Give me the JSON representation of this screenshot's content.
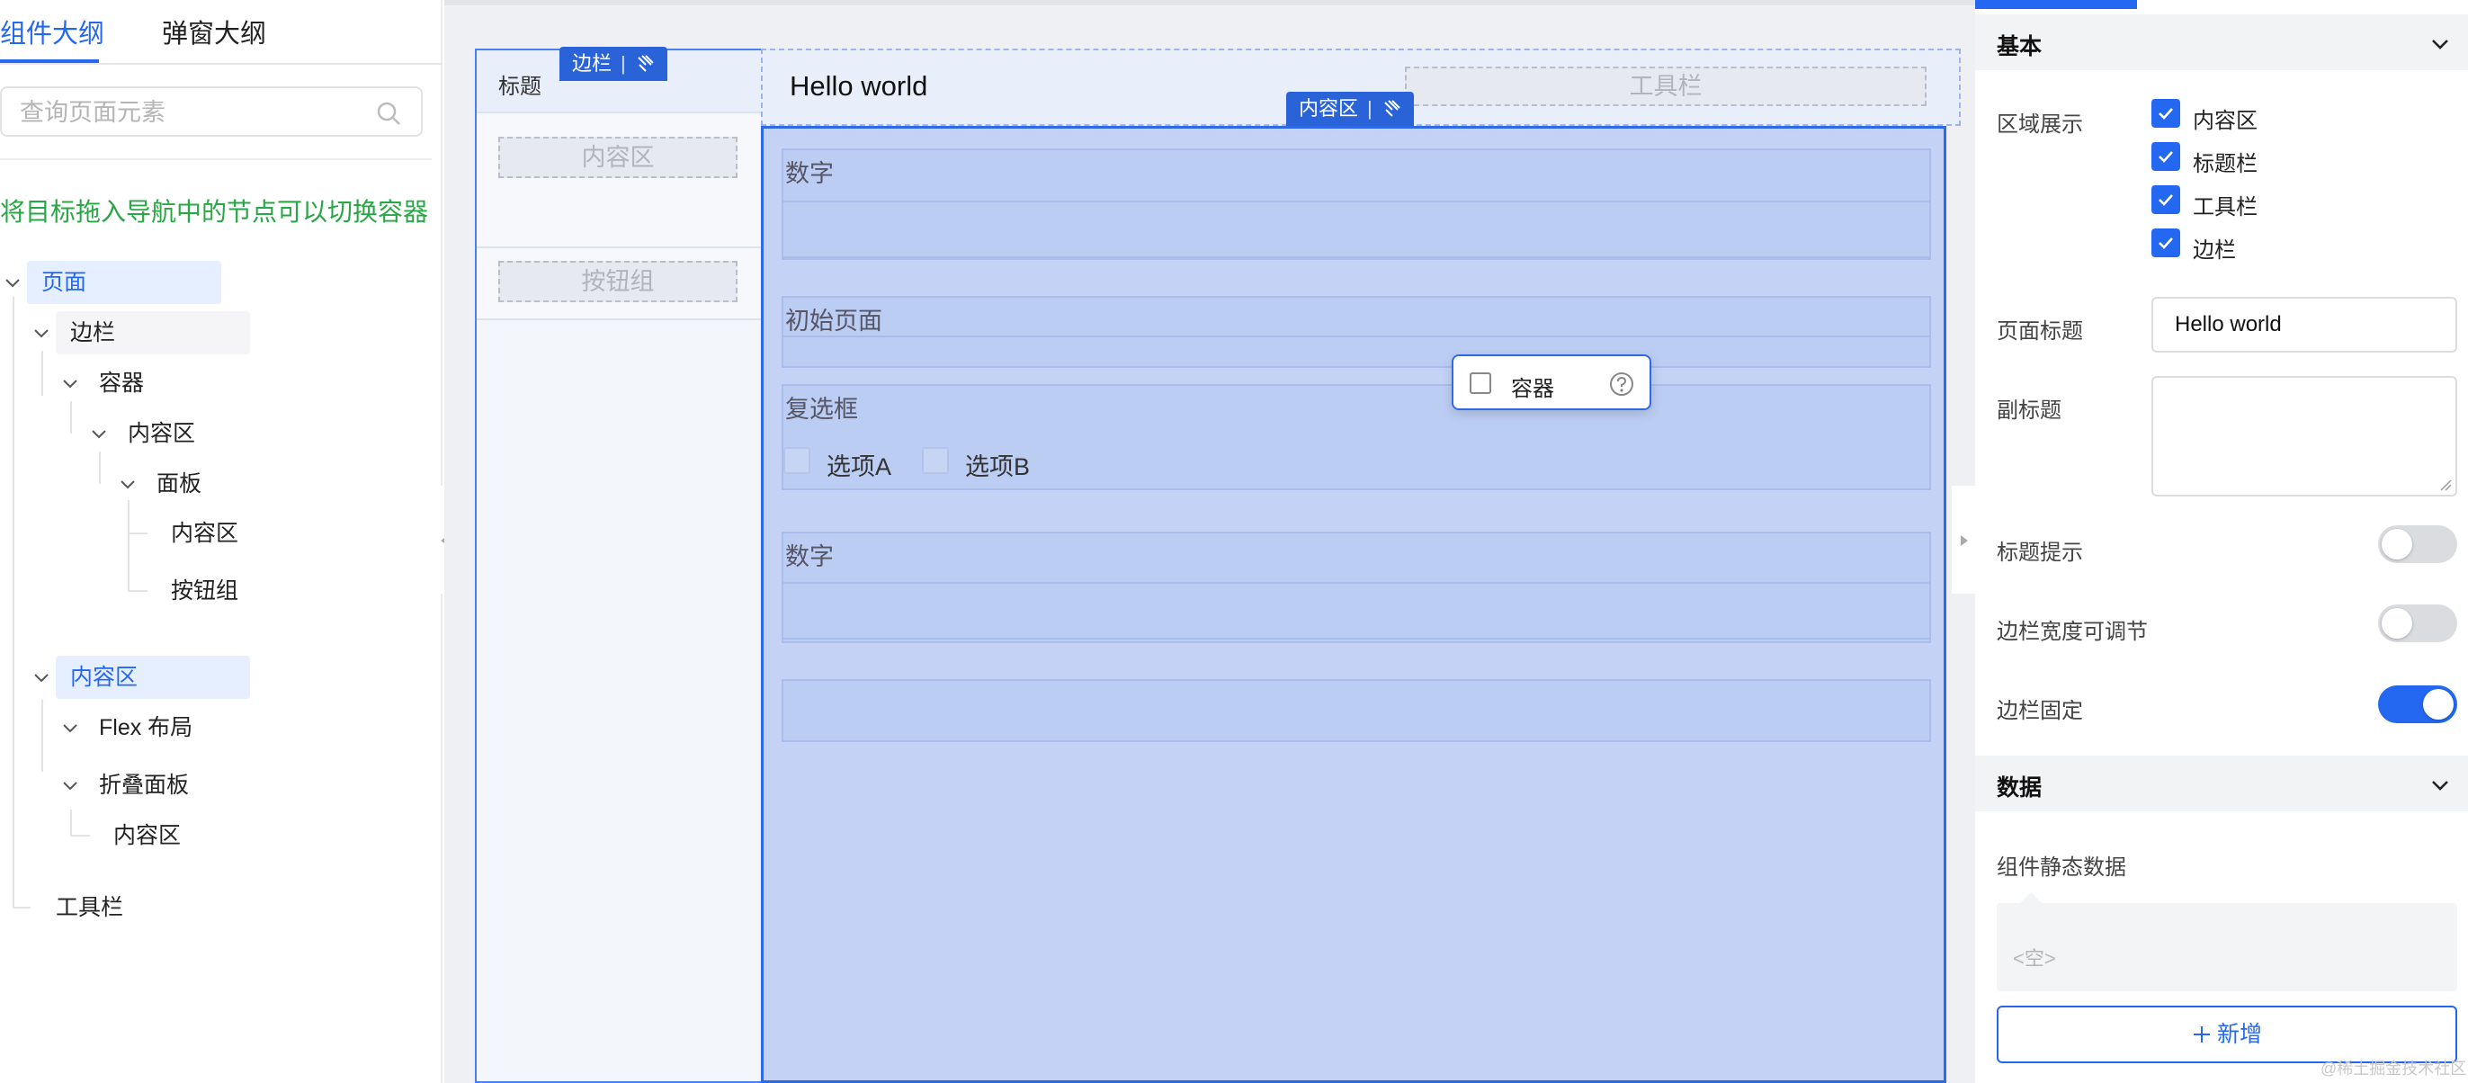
{
  "left_panel": {
    "tabs": [
      {
        "label": "组件大纲",
        "active": true
      },
      {
        "label": "弹窗大纲",
        "active": false
      }
    ],
    "search_placeholder": "查询页面元素",
    "hint": "将目标拖入导航中的节点可以切换容器",
    "tree": {
      "page": "页面",
      "aside": "边栏",
      "container": "容器",
      "content_a": "内容区",
      "panel": "面板",
      "panel_content": "内容区",
      "panel_buttons": "按钮组",
      "content_b": "内容区",
      "flex": "Flex 布局",
      "collapse": "折叠面板",
      "collapse_content": "内容区",
      "toolbar": "工具栏"
    }
  },
  "canvas": {
    "aside_title": "标题",
    "aside_tag": "边栏",
    "aside_slots": [
      "内容区",
      "按钮组"
    ],
    "header_title": "Hello world",
    "toolbar_slot": "工具栏",
    "content_tag": "内容区",
    "blocks": {
      "number1": "数字",
      "initial_page": "初始页面",
      "checkbox_group": "复选框",
      "option_a": "选项A",
      "option_b": "选项B",
      "number2": "数字"
    },
    "popover": {
      "label": "容器"
    }
  },
  "right_panel": {
    "basic": {
      "title": "基本",
      "region_label": "区域展示",
      "regions": [
        "内容区",
        "标题栏",
        "工具栏",
        "边栏"
      ],
      "page_title_label": "页面标题",
      "page_title_value": "Hello world",
      "subtitle_label": "副标题",
      "title_tip_label": "标题提示",
      "aside_resizable_label": "边栏宽度可调节",
      "aside_fixed_label": "边栏固定",
      "title_tip_on": false,
      "aside_resizable_on": false,
      "aside_fixed_on": true
    },
    "data": {
      "title": "数据",
      "static_label": "组件静态数据",
      "empty": "<空>",
      "add_label": "新增"
    },
    "watermark": "@稀土掘金技术社区"
  },
  "colors": {
    "accent": "#2468f2",
    "hint_green": "#28a745",
    "content_bg": "#c3d2f5"
  }
}
